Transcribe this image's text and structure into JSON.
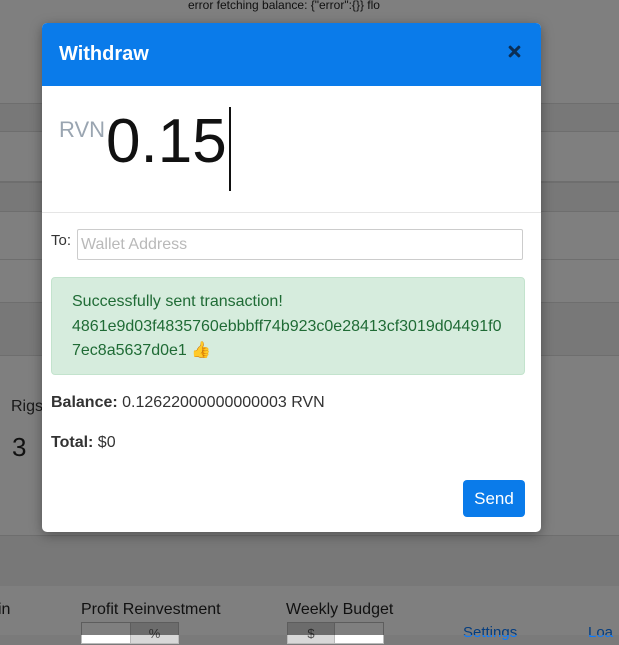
{
  "background": {
    "error_text": "error fetching balance: {\"error\":{}} flo",
    "rigs_label": "Rigs",
    "rigs_value": "3",
    "bottom_labels": {
      "left_partial": "in",
      "profit_reinvestment": "Profit Reinvestment",
      "weekly_budget": "Weekly Budget"
    },
    "addons": {
      "percent": "%",
      "dollar": "$"
    },
    "links": {
      "settings": "Settings",
      "partial": "Loa"
    }
  },
  "modal": {
    "title": "Withdraw",
    "close_icon": "close-icon",
    "currency": "RVN",
    "amount": "0.15",
    "to_label": "To:",
    "wallet_placeholder": "Wallet Address",
    "wallet_value": "",
    "alert": {
      "line1": "Successfully sent transaction!",
      "hash": "4861e9d03f4835760ebbbff74b923c0e28413cf3019d04491f07ec8a5637d0e1",
      "emoji": "👍"
    },
    "balance_label": "Balance:",
    "balance_value": " 0.12622000000000003 RVN",
    "total_label": "Total:",
    "total_value": " $0",
    "send_label": "Send"
  },
  "colors": {
    "header_blue": "#0a7bea",
    "success_bg": "#d6ecdd",
    "success_text": "#1f6b35"
  }
}
